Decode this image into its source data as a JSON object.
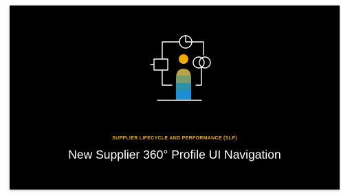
{
  "slide": {
    "subtitle": "SUPPLIER LIFECYCLE AND PERFORMANCE (SLP)",
    "title": "New Supplier 360° Profile UI Navigation",
    "icon": "supplier-profile-line-icon"
  },
  "colors": {
    "background": "#000000",
    "subtitle": "#f0ab00",
    "title": "#ffffff",
    "icon_line": "#ffffff",
    "figure_head": "#f0ab00",
    "figure_band_1": "#b8a24a",
    "figure_band_2": "#5e9a72",
    "figure_band_3": "#2e8fa8",
    "figure_band_4": "#1a8fd6"
  }
}
